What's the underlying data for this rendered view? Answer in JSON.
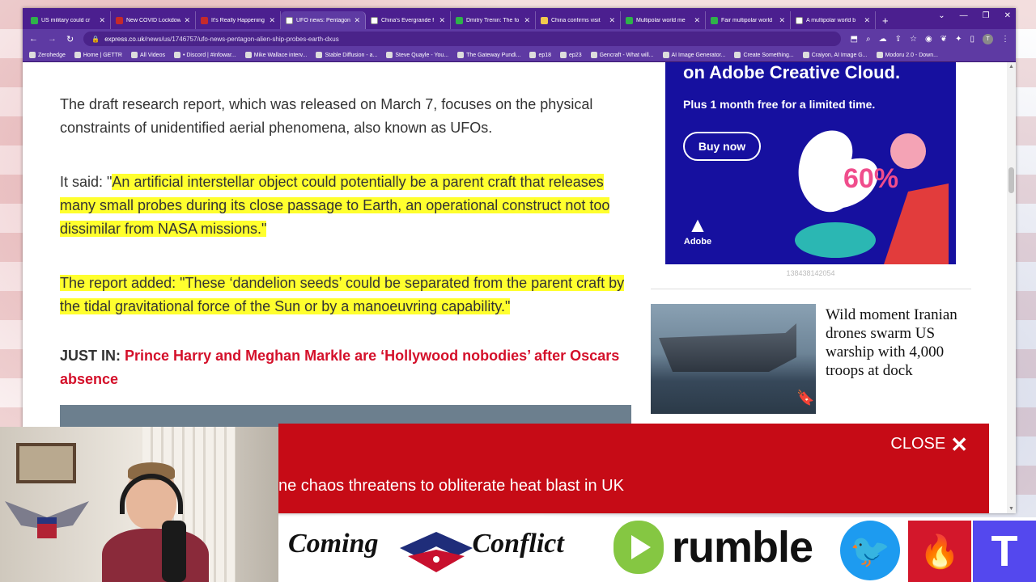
{
  "browser": {
    "tabs": [
      {
        "title": "US military could cr",
        "fav": "g",
        "active": false
      },
      {
        "title": "New COVID Lockdow",
        "fav": "r",
        "active": false
      },
      {
        "title": "It's Really Happening",
        "fav": "r",
        "active": false
      },
      {
        "title": "UFO news: Pentagon",
        "fav": "w",
        "active": true
      },
      {
        "title": "China's Evergrande f",
        "fav": "w",
        "active": false
      },
      {
        "title": "Dmitry Trenin: The fo",
        "fav": "g",
        "active": false
      },
      {
        "title": "China confirms visit",
        "fav": "y",
        "active": false
      },
      {
        "title": "Multipolar world me",
        "fav": "g",
        "active": false
      },
      {
        "title": "Fair multipolar world",
        "fav": "g",
        "active": false
      },
      {
        "title": "A multipolar world b",
        "fav": "w",
        "active": false
      }
    ],
    "url_domain": "express.co.uk",
    "url_path": "/news/us/1746757/ufo-news-pentagon-alien-ship-probes-earth-dxus",
    "profile_initial": "T",
    "bookmarks": [
      "Zerohedge",
      "Home | GETTR",
      "All Videos",
      "• Discord | #infowar...",
      "Mike Wallace interv...",
      "Stable Diffusion - a...",
      "Steve Quayle - You...",
      "The Gateway Pundi...",
      "ep18",
      "ep23",
      "Gencraft - What will...",
      "AI Image Generator...",
      "Create Something...",
      "Craiyon, AI Image G...",
      "Modoru 2.0 - Down..."
    ]
  },
  "article": {
    "para1": "The draft research report, which was released on March 7, focuses on the physical constraints of unidentified aerial phenomena, also known as UFOs.",
    "para2_prefix": "It said: \"",
    "para2_quote": "An artificial interstellar object could potentially be a parent craft that releases many small probes during its close passage to Earth, an operational construct not too dissimilar from NASA missions.\"",
    "para3": "The report added: \"These ‘dandelion seeds’ could be separated from the parent craft by the tidal gravitational force of the Sun or by a manoeuvring capability.\"",
    "justin_label": "JUST IN:",
    "justin_link": "Prince Harry and Meghan Markle are ‘Hollywood nobodies’ after Oscars absence"
  },
  "ad": {
    "headline": "on Adobe Creative Cloud.",
    "sub": "Plus 1 month free for a limited time.",
    "button": "Buy now",
    "brand": "Adobe",
    "percent": "60%",
    "id": "138438142054"
  },
  "sidebar_story": {
    "title": "Wild moment Iranian drones swarm US warship with 4,000 troops at dock"
  },
  "overlay": {
    "close_label": "CLOSE",
    "ticker": "ne chaos threatens to obliterate heat blast in UK"
  },
  "branding": {
    "show_word1": "Coming",
    "show_word2": "Conflict",
    "rumble": "rumble"
  }
}
